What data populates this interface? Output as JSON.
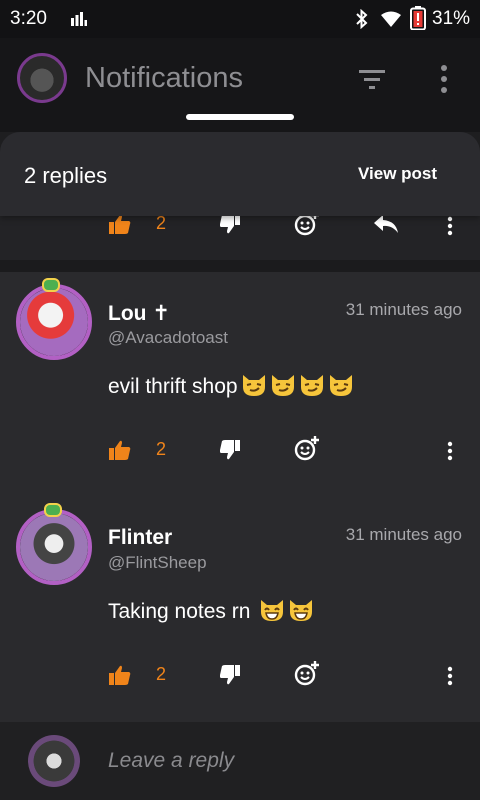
{
  "status_bar": {
    "time": "3:20",
    "battery_percent": "31%",
    "icons": [
      "signal-bars-icon",
      "bluetooth-icon",
      "wifi-icon",
      "battery-icon"
    ]
  },
  "app_bar": {
    "title": "Notifications",
    "icons": [
      "profile-avatar",
      "filter-icon",
      "more-vert-icon"
    ]
  },
  "sheet": {
    "replies_label": "2 replies",
    "view_post_label": "View post"
  },
  "parent_post": {
    "likes": "2"
  },
  "comments": [
    {
      "username": "Lou",
      "username_suffix": "✝",
      "handle": "@Avacadotoast",
      "time_ago": "31 minutes ago",
      "text": "evil thrift shop",
      "emoji": [
        "smirk-cat-emoji",
        "smirk-cat-emoji",
        "smirk-cat-emoji",
        "smirk-cat-emoji"
      ],
      "likes": "2"
    },
    {
      "username": "Flinter",
      "username_suffix": "",
      "handle": "@FlintSheep",
      "time_ago": "31 minutes ago",
      "text": "Taking notes rn",
      "emoji": [
        "grin-cat-emoji",
        "grin-cat-emoji"
      ],
      "likes": "2"
    }
  ],
  "reply_bar": {
    "placeholder": "Leave a reply"
  },
  "colors": {
    "accent_orange": "#f0841a",
    "avatar_ring": "#b260c4",
    "background": "#1e1e20",
    "card": "#2a2a2d"
  }
}
